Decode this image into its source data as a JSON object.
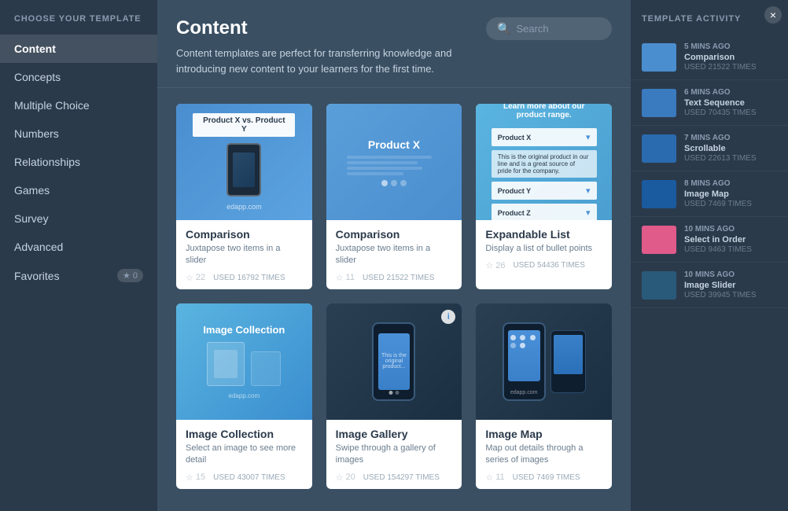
{
  "sidebar": {
    "title": "CHOOSE YOUR TEMPLATE",
    "items": [
      {
        "id": "content",
        "label": "Content",
        "active": true
      },
      {
        "id": "concepts",
        "label": "Concepts",
        "active": false
      },
      {
        "id": "multiple-choice",
        "label": "Multiple Choice",
        "active": false
      },
      {
        "id": "numbers",
        "label": "Numbers",
        "active": false
      },
      {
        "id": "relationships",
        "label": "Relationships",
        "active": false
      },
      {
        "id": "games",
        "label": "Games",
        "active": false
      },
      {
        "id": "survey",
        "label": "Survey",
        "active": false
      },
      {
        "id": "advanced",
        "label": "Advanced",
        "active": false
      },
      {
        "id": "favorites",
        "label": "Favorites",
        "active": false,
        "badge": "0"
      }
    ]
  },
  "main": {
    "title": "Content",
    "description": "Content templates are perfect for transferring knowledge and introducing new content to your learners for the first time.",
    "search_placeholder": "Search",
    "templates": [
      {
        "name": "Comparison",
        "desc": "Juxtapose two items in a slider",
        "stars": 22,
        "used": "USED 16792 TIMES",
        "thumb_type": "comparison1"
      },
      {
        "name": "Comparison",
        "desc": "Juxtapose two items in a slider",
        "stars": 11,
        "used": "USED 21522 TIMES",
        "thumb_type": "comparison2"
      },
      {
        "name": "Expandable List",
        "desc": "Display a list of bullet points",
        "stars": 26,
        "used": "USED 54436 TIMES",
        "thumb_type": "expandable"
      },
      {
        "name": "Image Collection",
        "desc": "Select an image to see more detail",
        "stars": 15,
        "used": "USED 43007 TIMES",
        "thumb_type": "image-collection"
      },
      {
        "name": "Image Gallery",
        "desc": "Swipe through a gallery of images",
        "stars": 20,
        "used": "USED 154297 TIMES",
        "thumb_type": "image-gallery"
      },
      {
        "name": "Image Map",
        "desc": "Map out details through a series of images",
        "stars": 11,
        "used": "USED 7469 TIMES",
        "thumb_type": "image-map"
      }
    ]
  },
  "activity": {
    "title": "TEMPLATE ACTIVITY",
    "items": [
      {
        "time": "5 MINS AGO",
        "name": "Comparison",
        "used": "USED 21522 TIMES",
        "color": "#4a90d9"
      },
      {
        "time": "6 MINS AGO",
        "name": "Text Sequence",
        "used": "USED 70435 TIMES",
        "color": "#3a7abf"
      },
      {
        "time": "7 MINS AGO",
        "name": "Scrollable",
        "used": "USED 22613 TIMES",
        "color": "#2a6aaf"
      },
      {
        "time": "8 MINS AGO",
        "name": "Image Map",
        "used": "USED 7469 TIMES",
        "color": "#1a5a9f"
      },
      {
        "time": "10 MINS AGO",
        "name": "Select in Order",
        "used": "USED 9463 TIMES",
        "color": "#e05a8a"
      },
      {
        "time": "10 MINS AGO",
        "name": "Image Slider",
        "used": "USED 39945 TIMES",
        "color": "#2a5a7a"
      }
    ]
  },
  "close_label": "×"
}
